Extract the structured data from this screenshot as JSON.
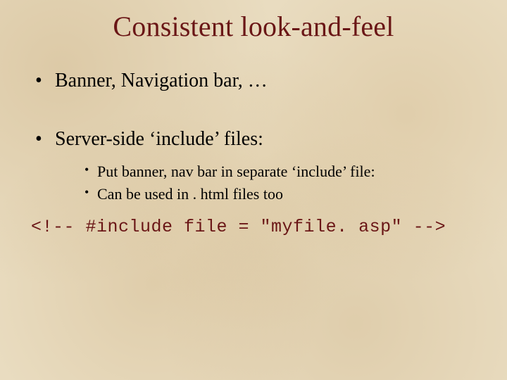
{
  "title": "Consistent look-and-feel",
  "bullets": {
    "b1": "Banner, Navigation bar, …",
    "b2": "Server-side ‘include’ files:",
    "sub1": "Put banner, nav bar in separate ‘include’ file:",
    "sub2": "Can be used in . html files too"
  },
  "code_line": "<!-- #include file = \"myfile. asp\" -->"
}
